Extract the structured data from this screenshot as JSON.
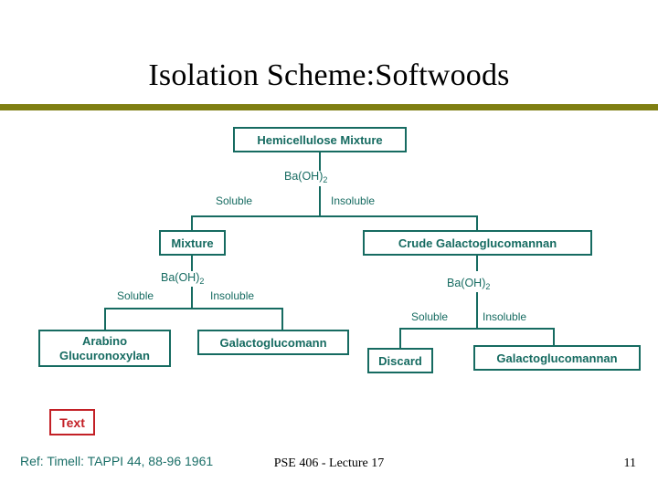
{
  "slide": {
    "title": "Isolation Scheme:Softwoods",
    "accent_rule_color": "#7f7f12",
    "node_color": "#166b61",
    "callout_color": "#c32026"
  },
  "flowchart": {
    "nodes": {
      "root": "Hemicellulose Mixture",
      "left_mixture": "Mixture",
      "right_crude": "Crude Galactoglucomannan",
      "arabino": "Arabino Glucuronoxylan",
      "galactoglucomann": "Galactoglucomann",
      "discard": "Discard",
      "galactoglucomannan": "Galactoglucomannan"
    },
    "edge_labels": {
      "reagent_1_prefix": "Ba(OH)",
      "reagent_1_sub": "2",
      "soluble_1": "Soluble",
      "insoluble_1": "Insoluble",
      "reagent_2_prefix": "Ba(OH)",
      "reagent_2_sub": "2",
      "soluble_2": "Soluble",
      "insoluble_2": "Insoluble",
      "reagent_3_prefix": "Ba(OH)",
      "reagent_3_sub": "2",
      "soluble_3": "Soluble",
      "insoluble_3": "Insoluble"
    }
  },
  "callout": {
    "label": "Text"
  },
  "footer": {
    "reference": "Ref:  Timell: TAPPI 44, 88-96 1961",
    "center": "PSE 406 - Lecture 17",
    "page_number": "11"
  }
}
